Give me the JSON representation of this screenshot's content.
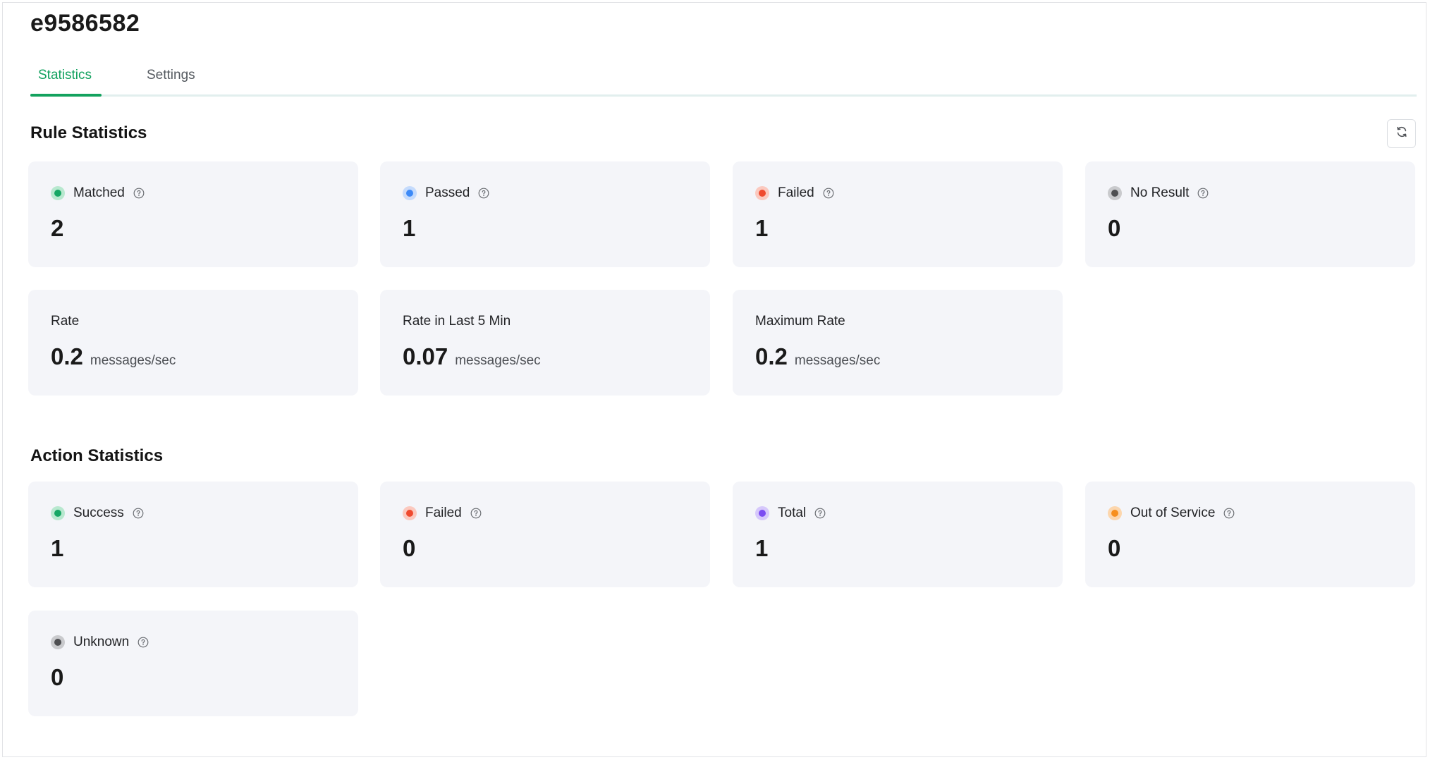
{
  "page": {
    "title": "e9586582"
  },
  "tabs": [
    {
      "label": "Statistics",
      "active": true
    },
    {
      "label": "Settings",
      "active": false
    }
  ],
  "rule_statistics": {
    "title": "Rule Statistics",
    "refresh_icon": "refresh-icon",
    "cards": [
      {
        "label": "Matched",
        "value": "2",
        "color": "#16a765",
        "ring": "#b8e8cf",
        "help": "question-circle-icon"
      },
      {
        "label": "Passed",
        "value": "1",
        "color": "#3d8af7",
        "ring": "#c5dbfc",
        "help": "question-circle-icon"
      },
      {
        "label": "Failed",
        "value": "1",
        "color": "#ef4a2f",
        "ring": "#fbc9bf",
        "help": "question-circle-icon"
      },
      {
        "label": "No Result",
        "value": "0",
        "color": "#4e4f52",
        "ring": "#c9cacd",
        "help": "question-circle-icon"
      }
    ],
    "rate_cards": [
      {
        "label": "Rate",
        "value": "0.2",
        "unit": "messages/sec"
      },
      {
        "label": "Rate in Last 5 Min",
        "value": "0.07",
        "unit": "messages/sec"
      },
      {
        "label": "Maximum Rate",
        "value": "0.2",
        "unit": "messages/sec"
      }
    ]
  },
  "action_statistics": {
    "title": "Action Statistics",
    "cards": [
      {
        "label": "Success",
        "value": "1",
        "color": "#16a765",
        "ring": "#b8e8cf",
        "help": "question-circle-icon"
      },
      {
        "label": "Failed",
        "value": "0",
        "color": "#ef4a2f",
        "ring": "#fbc9bf",
        "help": "question-circle-icon"
      },
      {
        "label": "Total",
        "value": "1",
        "color": "#7b4cf2",
        "ring": "#d6c8fb",
        "help": "question-circle-icon"
      },
      {
        "label": "Out of Service",
        "value": "0",
        "color": "#f78f1e",
        "ring": "#fcd6ad",
        "help": "question-circle-icon"
      },
      {
        "label": "Unknown",
        "value": "0",
        "color": "#4e4f52",
        "ring": "#c9cacd",
        "help": "question-circle-icon"
      }
    ]
  }
}
